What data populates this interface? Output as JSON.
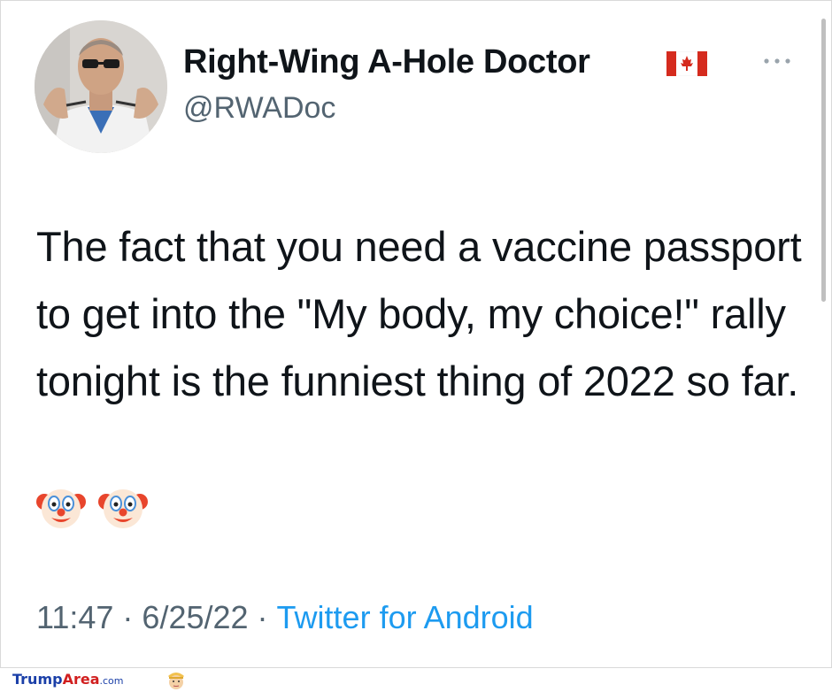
{
  "tweet": {
    "display_name": "Right-Wing A-Hole Doctor",
    "handle": "@RWADoc",
    "text": "The fact that you need a vaccine passport to get into the \"My body, my choice!\" rally tonight is the funniest thing of 2022 so far.",
    "time": "11:47",
    "date": "6/25/22",
    "source": "Twitter for Android",
    "separator": "·",
    "emojis": [
      "clown-face",
      "clown-face"
    ]
  },
  "icons": {
    "flag": "canada-flag-icon",
    "more": "more-options-icon"
  },
  "colors": {
    "handle_gray": "#536471",
    "link_blue": "#1d9bf0",
    "flag_red": "#d52b1e"
  },
  "watermark": {
    "brand_part1": "Trump",
    "brand_part2": "Area",
    "suffix": ".com"
  }
}
